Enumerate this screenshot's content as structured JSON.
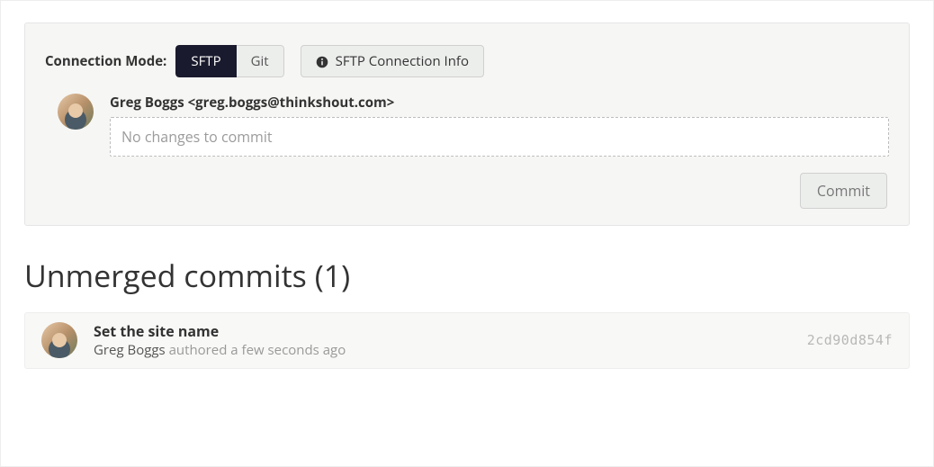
{
  "connection": {
    "label": "Connection Mode:",
    "modes": {
      "sftp": "SFTP",
      "git": "Git"
    },
    "active_mode": "sftp",
    "info_button": "SFTP Connection Info"
  },
  "commit_box": {
    "author_display": "Greg Boggs <greg.boggs@thinkshout.com>",
    "placeholder": "No changes to commit",
    "value": "",
    "commit_button": "Commit"
  },
  "section": {
    "unmerged_heading": "Unmerged commits (1)",
    "unmerged_count": 1
  },
  "commits": [
    {
      "title": "Set the site name",
      "author": "Greg Boggs",
      "meta_rest": "authored a few seconds ago",
      "hash": "2cd90d854f"
    }
  ]
}
